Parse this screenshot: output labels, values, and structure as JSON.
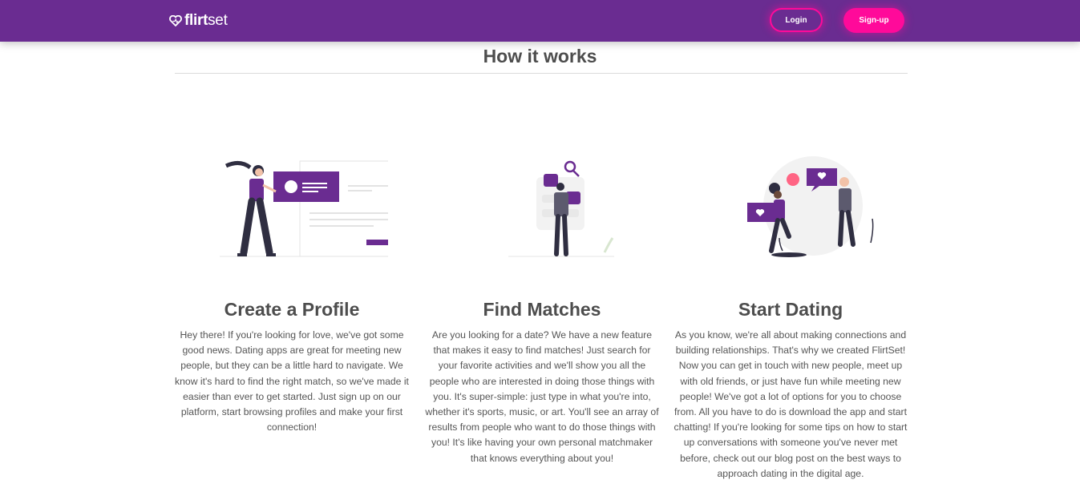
{
  "nav": {
    "logo_bold": "flirt",
    "logo_light": "set",
    "login_label": "Login",
    "signup_label": "Sign-up"
  },
  "section": {
    "title": "How it works"
  },
  "steps": [
    {
      "title": "Create a Profile",
      "text": "Hey there! If you're looking for love, we've got some good news. Dating apps are great for meeting new people, but they can be a little hard to navigate. We know it's hard to find the right match, so we've made it easier than ever to get started. Just sign up on our platform, start browsing profiles and make your first connection!"
    },
    {
      "title": "Find Matches",
      "text": "Are you looking for a date? We have a new feature that makes it easy to find matches! Just search for your favorite activities and we'll show you all the people who are interested in doing those things with you. It's super-simple: just type in what you're into, whether it's sports, music, or art. You'll see an array of results from people who want to do those things with you! It's like having your own personal matchmaker that knows everything about you!"
    },
    {
      "title": "Start Dating",
      "text": "As you know, we're all about making connections and building relationships. That's why we created FlirtSet! Now you can get in touch with new people, meet up with old friends, or just have fun while meeting new people! We've got a lot of options for you to choose from. All you have to do is download the app and start chatting! If you're looking for some tips on how to start up conversations with someone you've never met before, check out our blog post on the best ways to approach dating in the digital age."
    }
  ],
  "colors": {
    "brand_purple": "#6a2c91",
    "accent_pink": "#ff0a9a",
    "text_gray": "#4d4d4d"
  },
  "icons": [
    "heart-logo-icon",
    "profile-card-illustration",
    "search-matches-illustration",
    "dating-couple-illustration"
  ]
}
